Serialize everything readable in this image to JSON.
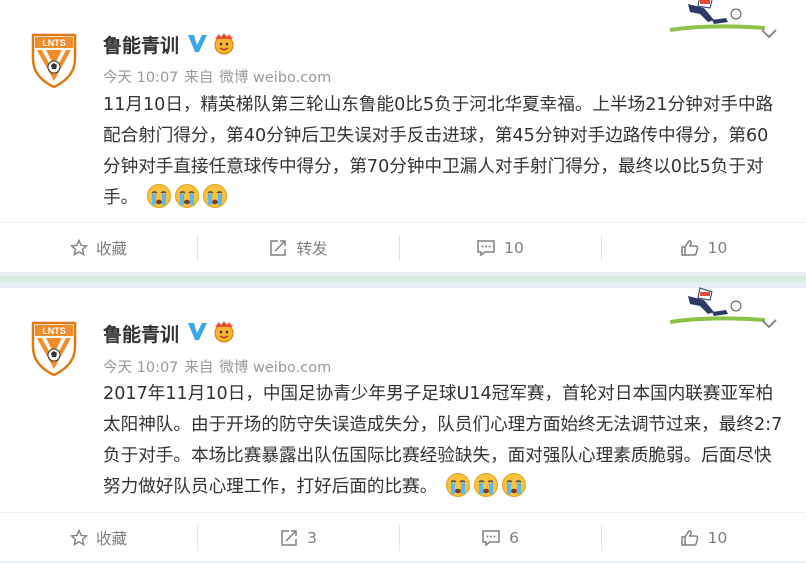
{
  "posts": [
    {
      "author": "鲁能青训",
      "time": "今天 10:07",
      "source_prefix": "来自",
      "source": "微博 weibo.com",
      "text": "11月10日，精英梯队第三轮山东鲁能0比5负于河北华夏幸福。上半场21分钟对手中路配合射门得分，第40分钟后卫失误对手反击进球，第45分钟对手边路传中得分，第60分钟对手直接任意球传中得分，第70分钟中卫漏人对手射门得分，最终以0比5负于对手。",
      "actions": {
        "favorite": "收藏",
        "repost": "转发",
        "comments": "10",
        "likes": "10"
      }
    },
    {
      "author": "鲁能青训",
      "time": "今天 10:07",
      "source_prefix": "来自",
      "source": "微博 weibo.com",
      "text": "2017年11月10日，中国足协青少年男子足球U14冠军赛，首轮对日本国内联赛亚军柏太阳神队。由于开场的防守失误造成失分，队员们心理方面始终无法调节过来，最终2:7负于对手。本场比赛暴露出队伍国际比赛经验缺失，面对强队心理素质脆弱。后面尽快努力做好队员心理工作，打好后面的比赛。",
      "actions": {
        "favorite": "收藏",
        "repost": "3",
        "comments": "6",
        "likes": "10"
      }
    }
  ],
  "logo_text": "LNTS",
  "colors": {
    "accent": "#f28c28",
    "verified": "#3fa7e8",
    "text": "#333333",
    "muted": "#999999"
  },
  "icons": [
    "lnts-logo-icon",
    "verified-v-icon",
    "cry-emoji-icon",
    "star-icon",
    "repost-icon",
    "comment-icon",
    "thumbs-up-icon",
    "chevron-down-icon",
    "soccer-player-icon"
  ]
}
